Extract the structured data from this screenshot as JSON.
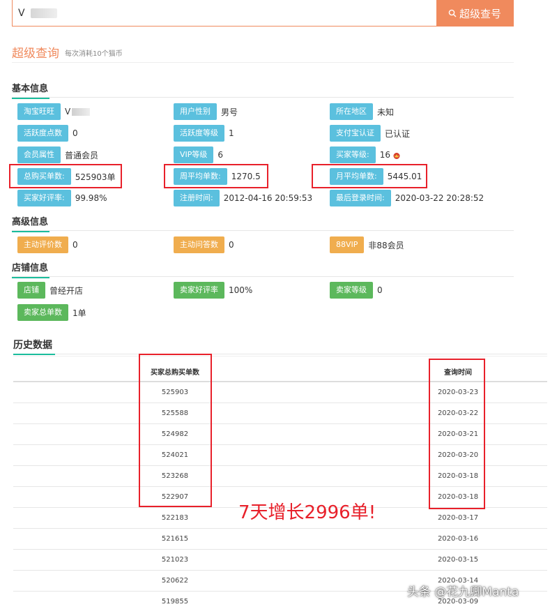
{
  "search": {
    "value": "V",
    "button_label": "超级查号"
  },
  "header": {
    "title": "超级查询",
    "subtitle": "每次消耗10个猫币"
  },
  "sections": {
    "basic": "基本信息",
    "advanced": "高级信息",
    "shop": "店铺信息",
    "history": "历史数据"
  },
  "basic": {
    "taobao_id": {
      "label": "淘宝旺旺",
      "value": "V"
    },
    "gender": {
      "label": "用户性别",
      "value": "男号"
    },
    "region": {
      "label": "所在地区",
      "value": "未知"
    },
    "activity_points": {
      "label": "活跃度点数",
      "value": "0"
    },
    "activity_level": {
      "label": "活跃度等级",
      "value": "1"
    },
    "alipay": {
      "label": "支付宝认证",
      "value": "已认证"
    },
    "member": {
      "label": "会员属性",
      "value": "普通会员"
    },
    "vip": {
      "label": "VIP等级",
      "value": "6"
    },
    "buyer_level": {
      "label": "买家等级:",
      "value": "16"
    },
    "total_orders": {
      "label": "总购买单数:",
      "value": "525903单"
    },
    "weekly_avg": {
      "label": "周平均单数:",
      "value": "1270.5"
    },
    "monthly_avg": {
      "label": "月平均单数:",
      "value": "5445.01"
    },
    "good_rate": {
      "label": "买家好评率:",
      "value": "99.98%"
    },
    "register_time": {
      "label": "注册时间:",
      "value": "2012-04-16 20:59:53"
    },
    "last_login": {
      "label": "最后登录时间:",
      "value": "2020-03-22 20:28:52"
    }
  },
  "advanced": {
    "active_review": {
      "label": "主动评价数",
      "value": "0"
    },
    "active_qa": {
      "label": "主动问答数",
      "value": "0"
    },
    "vip88": {
      "label": "88VIP",
      "value": "非88会员"
    }
  },
  "shop": {
    "shop": {
      "label": "店铺",
      "value": "曾经开店"
    },
    "seller_rate": {
      "label": "卖家好评率",
      "value": "100%"
    },
    "seller_level": {
      "label": "卖家等级",
      "value": "0"
    },
    "seller_total": {
      "label": "卖家总单数",
      "value": "1单"
    }
  },
  "history": {
    "col_orders": "买家总购买单数",
    "col_time": "查询时间",
    "rows": [
      {
        "orders": "525903",
        "time": "2020-03-23"
      },
      {
        "orders": "525588",
        "time": "2020-03-22"
      },
      {
        "orders": "524982",
        "time": "2020-03-21"
      },
      {
        "orders": "524021",
        "time": "2020-03-20"
      },
      {
        "orders": "523268",
        "time": "2020-03-18"
      },
      {
        "orders": "522907",
        "time": "2020-03-18"
      },
      {
        "orders": "522183",
        "time": "2020-03-17"
      },
      {
        "orders": "521615",
        "time": "2020-03-16"
      },
      {
        "orders": "521023",
        "time": "2020-03-15"
      },
      {
        "orders": "520622",
        "time": "2020-03-14"
      },
      {
        "orders": "519855",
        "time": "2020-03-09"
      }
    ]
  },
  "annotation": "7天增长2996单!",
  "watermark": "头条 @花九卿Manta",
  "colors": {
    "accent": "#f08a5d",
    "tag_blue": "#5bc0de",
    "tag_orange": "#f0ad4e",
    "tag_green": "#5cb85c",
    "highlight": "#e8202a",
    "section_underline": "#1abc9c"
  }
}
